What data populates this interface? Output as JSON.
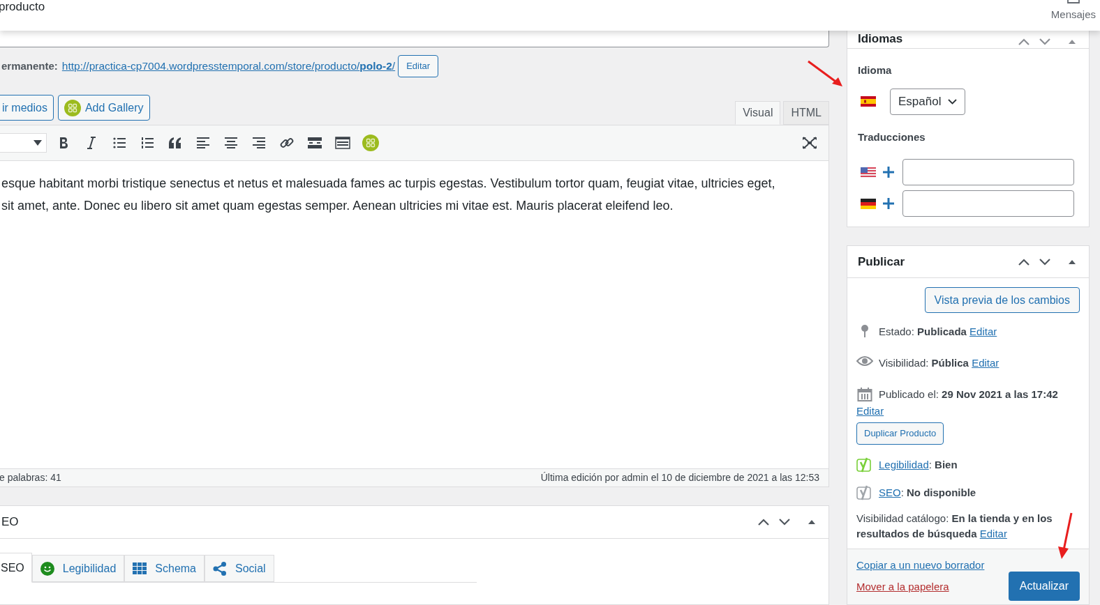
{
  "header": {
    "title": "producto",
    "messages_label": "Mensajes"
  },
  "permalink": {
    "label": "ermanente:",
    "url_base": "http://practica-cp7004.wordpresstemporal.com/store/producto/",
    "slug": "polo-2",
    "url_end": "/",
    "edit_button": "Editar"
  },
  "media_buttons": [
    {
      "label": "ir medios",
      "kind": "plain"
    },
    {
      "label": "Add Gallery",
      "kind": "gallery"
    }
  ],
  "editor": {
    "tabs": [
      {
        "label": "Visual",
        "selected": true
      },
      {
        "label": "HTML",
        "selected": false
      }
    ],
    "paragraphs": [
      "esque habitant morbi tristique senectus et netus et malesuada fames ac turpis egestas. Vestibulum tortor quam, feugiat vitae, ultricies eget,",
      "sit amet, ante. Donec eu libero sit amet quam egestas semper. Aenean ultricies mi vitae est. Mauris placerat eleifend leo."
    ],
    "word_count": "e palabras: 41",
    "last_edit": "Última edición por admin el 10 de diciembre de 2021 a las 12:53"
  },
  "seo_box": {
    "title": "EO",
    "tabs": [
      {
        "label": "SEO",
        "selected": true,
        "kind": "plain"
      },
      {
        "label": "Legibilidad",
        "selected": false,
        "kind": "smiley"
      },
      {
        "label": "Schema",
        "selected": false,
        "kind": "grid"
      },
      {
        "label": "Social",
        "selected": false,
        "kind": "share"
      }
    ]
  },
  "languages": {
    "title": "Idiomas",
    "language_label": "Idioma",
    "language_value": "Español",
    "translations_label": "Traducciones",
    "translations": [
      {
        "kind": "us"
      },
      {
        "kind": "de"
      }
    ]
  },
  "publish": {
    "title": "Publicar",
    "preview_button": "Vista previa de los cambios",
    "rows": [
      {
        "kind": "status",
        "text": "Estado: **Publicada**",
        "link": "Editar"
      },
      {
        "kind": "visibility",
        "text": "Visibilidad: **Pública**",
        "link": "Editar"
      },
      {
        "kind": "date",
        "text": "Publicado el: **29 Nov 2021 a las 17:42**",
        "link": "Editar"
      }
    ],
    "duplicate_button": "Duplicar Producto",
    "yoast": [
      {
        "link": "Legibilidad",
        "value": ": **Bien**",
        "color": "#7ad03a"
      },
      {
        "link": "SEO",
        "value": ": **No disponible**",
        "color": "#a0a5aa"
      }
    ],
    "catalog": {
      "text": "Visibilidad catálogo: **En la tienda y en los resultados de búsqueda**",
      "link": "Editar"
    },
    "copy_link": "Copiar a un nuevo borrador",
    "trash_link": "Mover a la papelera",
    "update_button": "Actualizar"
  }
}
